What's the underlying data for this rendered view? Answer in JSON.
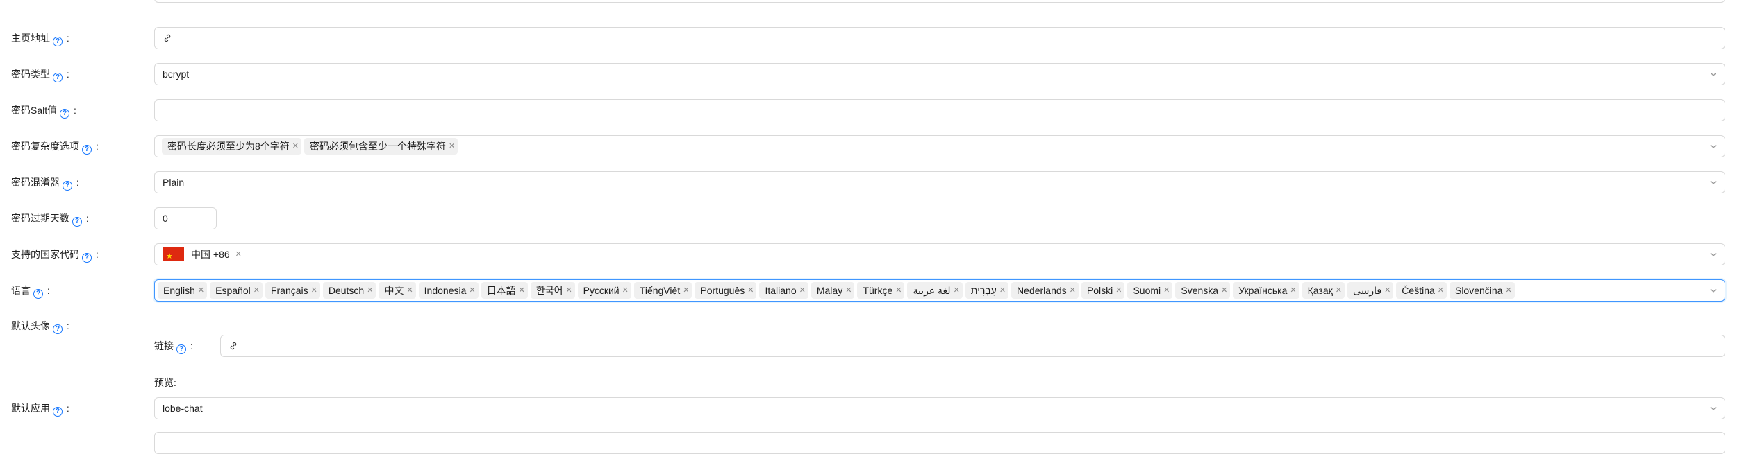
{
  "fields": {
    "homepage": {
      "label": "主页地址",
      "value": ""
    },
    "password_type": {
      "label": "密码类型",
      "value": "bcrypt"
    },
    "password_salt": {
      "label": "密码Salt值",
      "value": ""
    },
    "password_complexity": {
      "label": "密码复杂度选项",
      "tags": [
        "密码长度必须至少为8个字符",
        "密码必须包含至少一个特殊字符"
      ]
    },
    "password_obfuscator": {
      "label": "密码混淆器",
      "value": "Plain"
    },
    "password_expire_days": {
      "label": "密码过期天数",
      "value": "0"
    },
    "country_codes": {
      "label": "支持的国家代码",
      "tags": [
        "中国 +86"
      ]
    },
    "languages": {
      "label": "语言",
      "tags": [
        "English",
        "Español",
        "Français",
        "Deutsch",
        "中文",
        "Indonesia",
        "日本語",
        "한국어",
        "Русский",
        "TiếngViệt",
        "Português",
        "Italiano",
        "Malay",
        "Türkçe",
        "لغة عربية",
        "עִבְרִית",
        "Nederlands",
        "Polski",
        "Suomi",
        "Svenska",
        "Українська",
        "Қазақ",
        "فارسی",
        "Čeština",
        "Slovenčina"
      ]
    },
    "default_avatar": {
      "label": "默认头像",
      "link_label": "链接",
      "link_value": "",
      "preview_label": "预览:"
    },
    "default_application": {
      "label": "默认应用",
      "value": "lobe-chat"
    }
  },
  "colors": {
    "primary": "#1677ff",
    "border": "#d9d9d9",
    "tag_bg": "#f0f0f0"
  },
  "icons": {
    "help": "question-circle-icon",
    "link": "link-icon",
    "dropdown": "chevron-down-icon",
    "tag_close": "close-icon"
  }
}
